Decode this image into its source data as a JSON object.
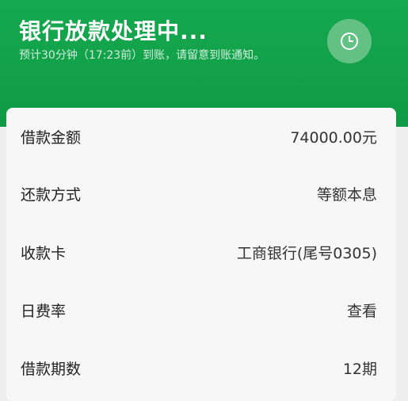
{
  "header": {
    "title": "银行放款处理中...",
    "subtitle": "预计30分钟（17:23前）到账，请留意到账通知。",
    "status_icon": "clock-icon"
  },
  "details": {
    "rows": [
      {
        "label": "借款金额",
        "value": "74000.00元"
      },
      {
        "label": "还款方式",
        "value": "等额本息"
      },
      {
        "label": "收款卡",
        "value": "工商银行(尾号0305)"
      },
      {
        "label": "日费率",
        "value": "查看"
      },
      {
        "label": "借款期数",
        "value": "12期"
      }
    ]
  },
  "colors": {
    "header_green": "#15a94f",
    "card_bg": "#f7f7f7"
  }
}
